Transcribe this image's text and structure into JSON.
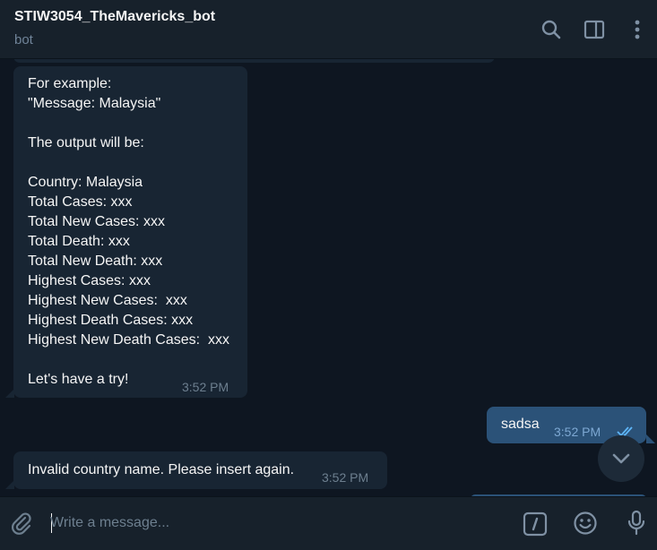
{
  "header": {
    "title": "STIW3054_TheMavericks_bot",
    "status": "bot",
    "icons": [
      "search-icon",
      "sidebar-toggle-icon",
      "more-vertical-icon"
    ]
  },
  "messages": [
    {
      "direction": "incoming",
      "lines": [
        "For example:",
        "\"Message: Malaysia\"",
        "",
        "The output will be:",
        "",
        "Country: Malaysia",
        "Total Cases: xxx",
        "Total New Cases: xxx",
        "Total Death: xxx",
        "Total New Death: xxx",
        "Highest Cases: xxx",
        "Highest New Cases:  xxx",
        "Highest Death Cases: xxx",
        "Highest New Death Cases:  xxx",
        "",
        "Let's have a try!"
      ],
      "time": "3:52 PM"
    },
    {
      "direction": "outgoing",
      "text": "sadsa",
      "time": "3:52 PM",
      "status": "read"
    },
    {
      "direction": "incoming",
      "text": "Invalid country name. Please insert again.",
      "time": "3:52 PM"
    }
  ],
  "composer": {
    "placeholder": "Write a message...",
    "icons": [
      "attach-icon",
      "bot-commands-icon",
      "emoji-icon",
      "microphone-icon"
    ]
  },
  "colors": {
    "background": "#0e1621",
    "panel": "#17212b",
    "incoming_bubble": "#182533",
    "outgoing_bubble": "#2b5278",
    "accent": "#5eb5f7"
  }
}
